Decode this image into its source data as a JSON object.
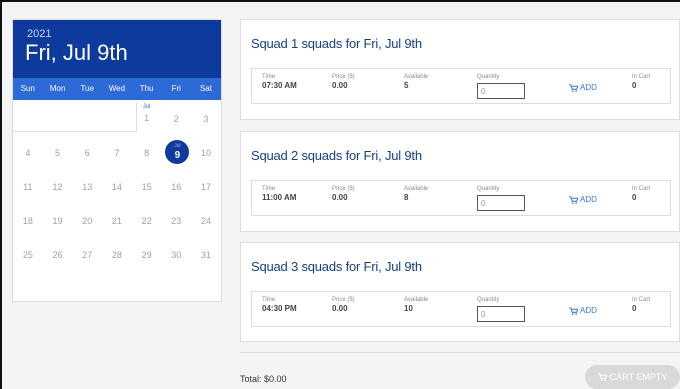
{
  "calendar": {
    "year": "2021",
    "date_label": "Fri, Jul 9th",
    "weekdays": [
      "Sun",
      "Mon",
      "Tue",
      "Wed",
      "Thu",
      "Fri",
      "Sat"
    ],
    "month_abbr": "Jul",
    "selected_day": "9",
    "weeks": [
      [
        "",
        "",
        "",
        "",
        "1",
        "2",
        "3"
      ],
      [
        "4",
        "5",
        "6",
        "7",
        "8",
        "9",
        "10"
      ],
      [
        "11",
        "12",
        "13",
        "14",
        "15",
        "16",
        "17"
      ],
      [
        "18",
        "19",
        "20",
        "21",
        "22",
        "23",
        "24"
      ],
      [
        "25",
        "26",
        "27",
        "28",
        "29",
        "30",
        "31"
      ]
    ]
  },
  "labels": {
    "time": "Time",
    "price": "Price ($)",
    "available": "Available",
    "quantity": "Quantity",
    "add": "ADD",
    "in_cart": "In Cart"
  },
  "squads": [
    {
      "title": "Squad 1 squads for Fri, Jul 9th",
      "time": "07:30 AM",
      "price": "0.00",
      "available": "5",
      "quantity": "0",
      "in_cart": "0"
    },
    {
      "title": "Squad 2 squads for Fri, Jul 9th",
      "time": "11:00 AM",
      "price": "0.00",
      "available": "8",
      "quantity": "0",
      "in_cart": "0"
    },
    {
      "title": "Squad 3 squads for Fri, Jul 9th",
      "time": "04:30 PM",
      "price": "0.00",
      "available": "10",
      "quantity": "0",
      "in_cart": "0"
    }
  ],
  "footer": {
    "total": "Total: $0.00",
    "cart_button": "CART EMPTY"
  },
  "colors": {
    "header_blue": "#0d3a9c",
    "weekday_blue": "#2d6ad8",
    "title_blue": "#17407f",
    "link_blue": "#3a78d6",
    "disabled_gray": "#d9d9d9"
  }
}
